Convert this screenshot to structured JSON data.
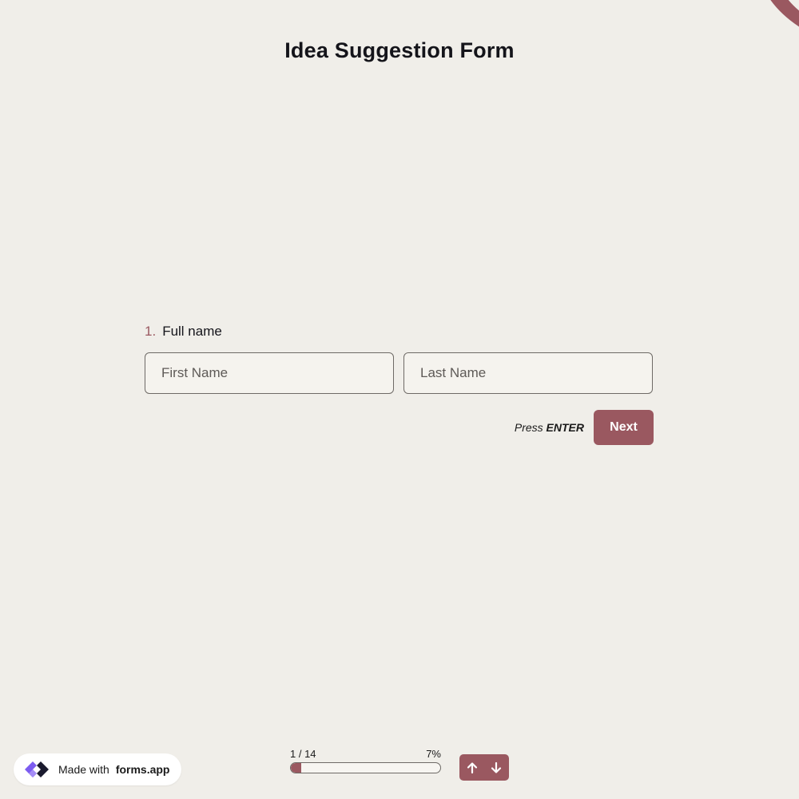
{
  "form": {
    "title": "Idea Suggestion Form"
  },
  "question": {
    "number": "1.",
    "label": "Full name",
    "first_name_placeholder": "First Name",
    "last_name_placeholder": "Last Name",
    "first_name_value": "",
    "last_name_value": ""
  },
  "actions": {
    "press_prefix": "Press",
    "press_key": "ENTER",
    "next_label": "Next"
  },
  "progress": {
    "counter": "1 / 14",
    "percent_label": "7%",
    "fraction": 0.07
  },
  "badge": {
    "prefix": "Made with",
    "brand": "forms.app"
  },
  "nav": {
    "up_icon": "arrow-up-icon",
    "down_icon": "arrow-down-icon"
  },
  "colors": {
    "background": "#f0eee9",
    "accent": "#9a5860",
    "text": "#14141a"
  }
}
